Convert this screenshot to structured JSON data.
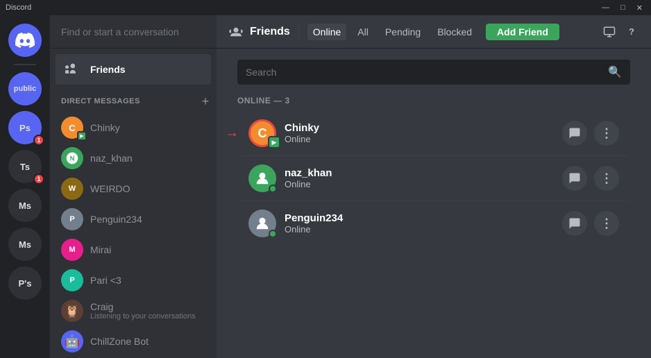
{
  "titleBar": {
    "title": "Discord",
    "minimize": "—",
    "maximize": "□",
    "close": "✕"
  },
  "serverSidebar": {
    "homeIcon": "🏠",
    "servers": [
      {
        "id": "public",
        "label": "public",
        "color": "#5865f2"
      },
      {
        "id": "ps",
        "label": "Ps",
        "color": "#5865f2"
      },
      {
        "id": "ts",
        "label": "Ts",
        "color": "#2f3136"
      },
      {
        "id": "ms1",
        "label": "Ms",
        "color": "#2f3136"
      },
      {
        "id": "ms2",
        "label": "Ms",
        "color": "#2f3136"
      },
      {
        "id": "ps2",
        "label": "P's",
        "color": "#2f3136"
      }
    ],
    "addServerLabel": "+"
  },
  "dmSidebar": {
    "searchPlaceholder": "Find or start a conversation",
    "friendsLabel": "Friends",
    "directMessagesLabel": "DIRECT MESSAGES",
    "addDmLabel": "+",
    "dmItems": [
      {
        "id": "chinky",
        "name": "Chinky",
        "hasGameBadge": true,
        "avatarColor": "#f48c2f"
      },
      {
        "id": "naz_khan",
        "name": "naz_khan",
        "avatarColor": "#3ba55d"
      },
      {
        "id": "weirdo",
        "name": "WEIRDO",
        "avatarColor": "#8b6914"
      },
      {
        "id": "penguin234",
        "name": "Penguin234",
        "avatarColor": "#747f8d"
      },
      {
        "id": "mirai",
        "name": "Mirai",
        "avatarColor": "#e91e8c"
      },
      {
        "id": "pari3",
        "name": "Pari <3",
        "avatarColor": "#1abc9c"
      },
      {
        "id": "craig",
        "name": "Craig",
        "sub": "Listening to your conversations",
        "avatarColor": "#5c4033"
      },
      {
        "id": "chillzone",
        "name": "ChillZone Bot",
        "avatarColor": "#5865f2"
      }
    ]
  },
  "topBar": {
    "friendsIconLabel": "👥",
    "title": "Friends",
    "tabs": [
      {
        "id": "online",
        "label": "Online",
        "active": true
      },
      {
        "id": "all",
        "label": "All"
      },
      {
        "id": "pending",
        "label": "Pending"
      },
      {
        "id": "blocked",
        "label": "Blocked"
      }
    ],
    "addFriendLabel": "Add Friend",
    "actions": [
      {
        "id": "monitor",
        "icon": "🖥"
      },
      {
        "id": "help",
        "icon": "?"
      }
    ]
  },
  "friendsContent": {
    "searchPlaceholder": "Search",
    "onlineHeader": "ONLINE — 3",
    "friends": [
      {
        "id": "chinky",
        "name": "Chinky",
        "status": "Online",
        "avatarColor": "#f48c2f",
        "hasGameBadge": true,
        "hasArrow": true
      },
      {
        "id": "naz_khan",
        "name": "naz_khan",
        "status": "Online",
        "avatarColor": "#3ba55d"
      },
      {
        "id": "penguin234",
        "name": "Penguin234",
        "status": "Online",
        "avatarColor": "#747f8d"
      }
    ],
    "messageIcon": "💬",
    "moreIcon": "⋮"
  }
}
